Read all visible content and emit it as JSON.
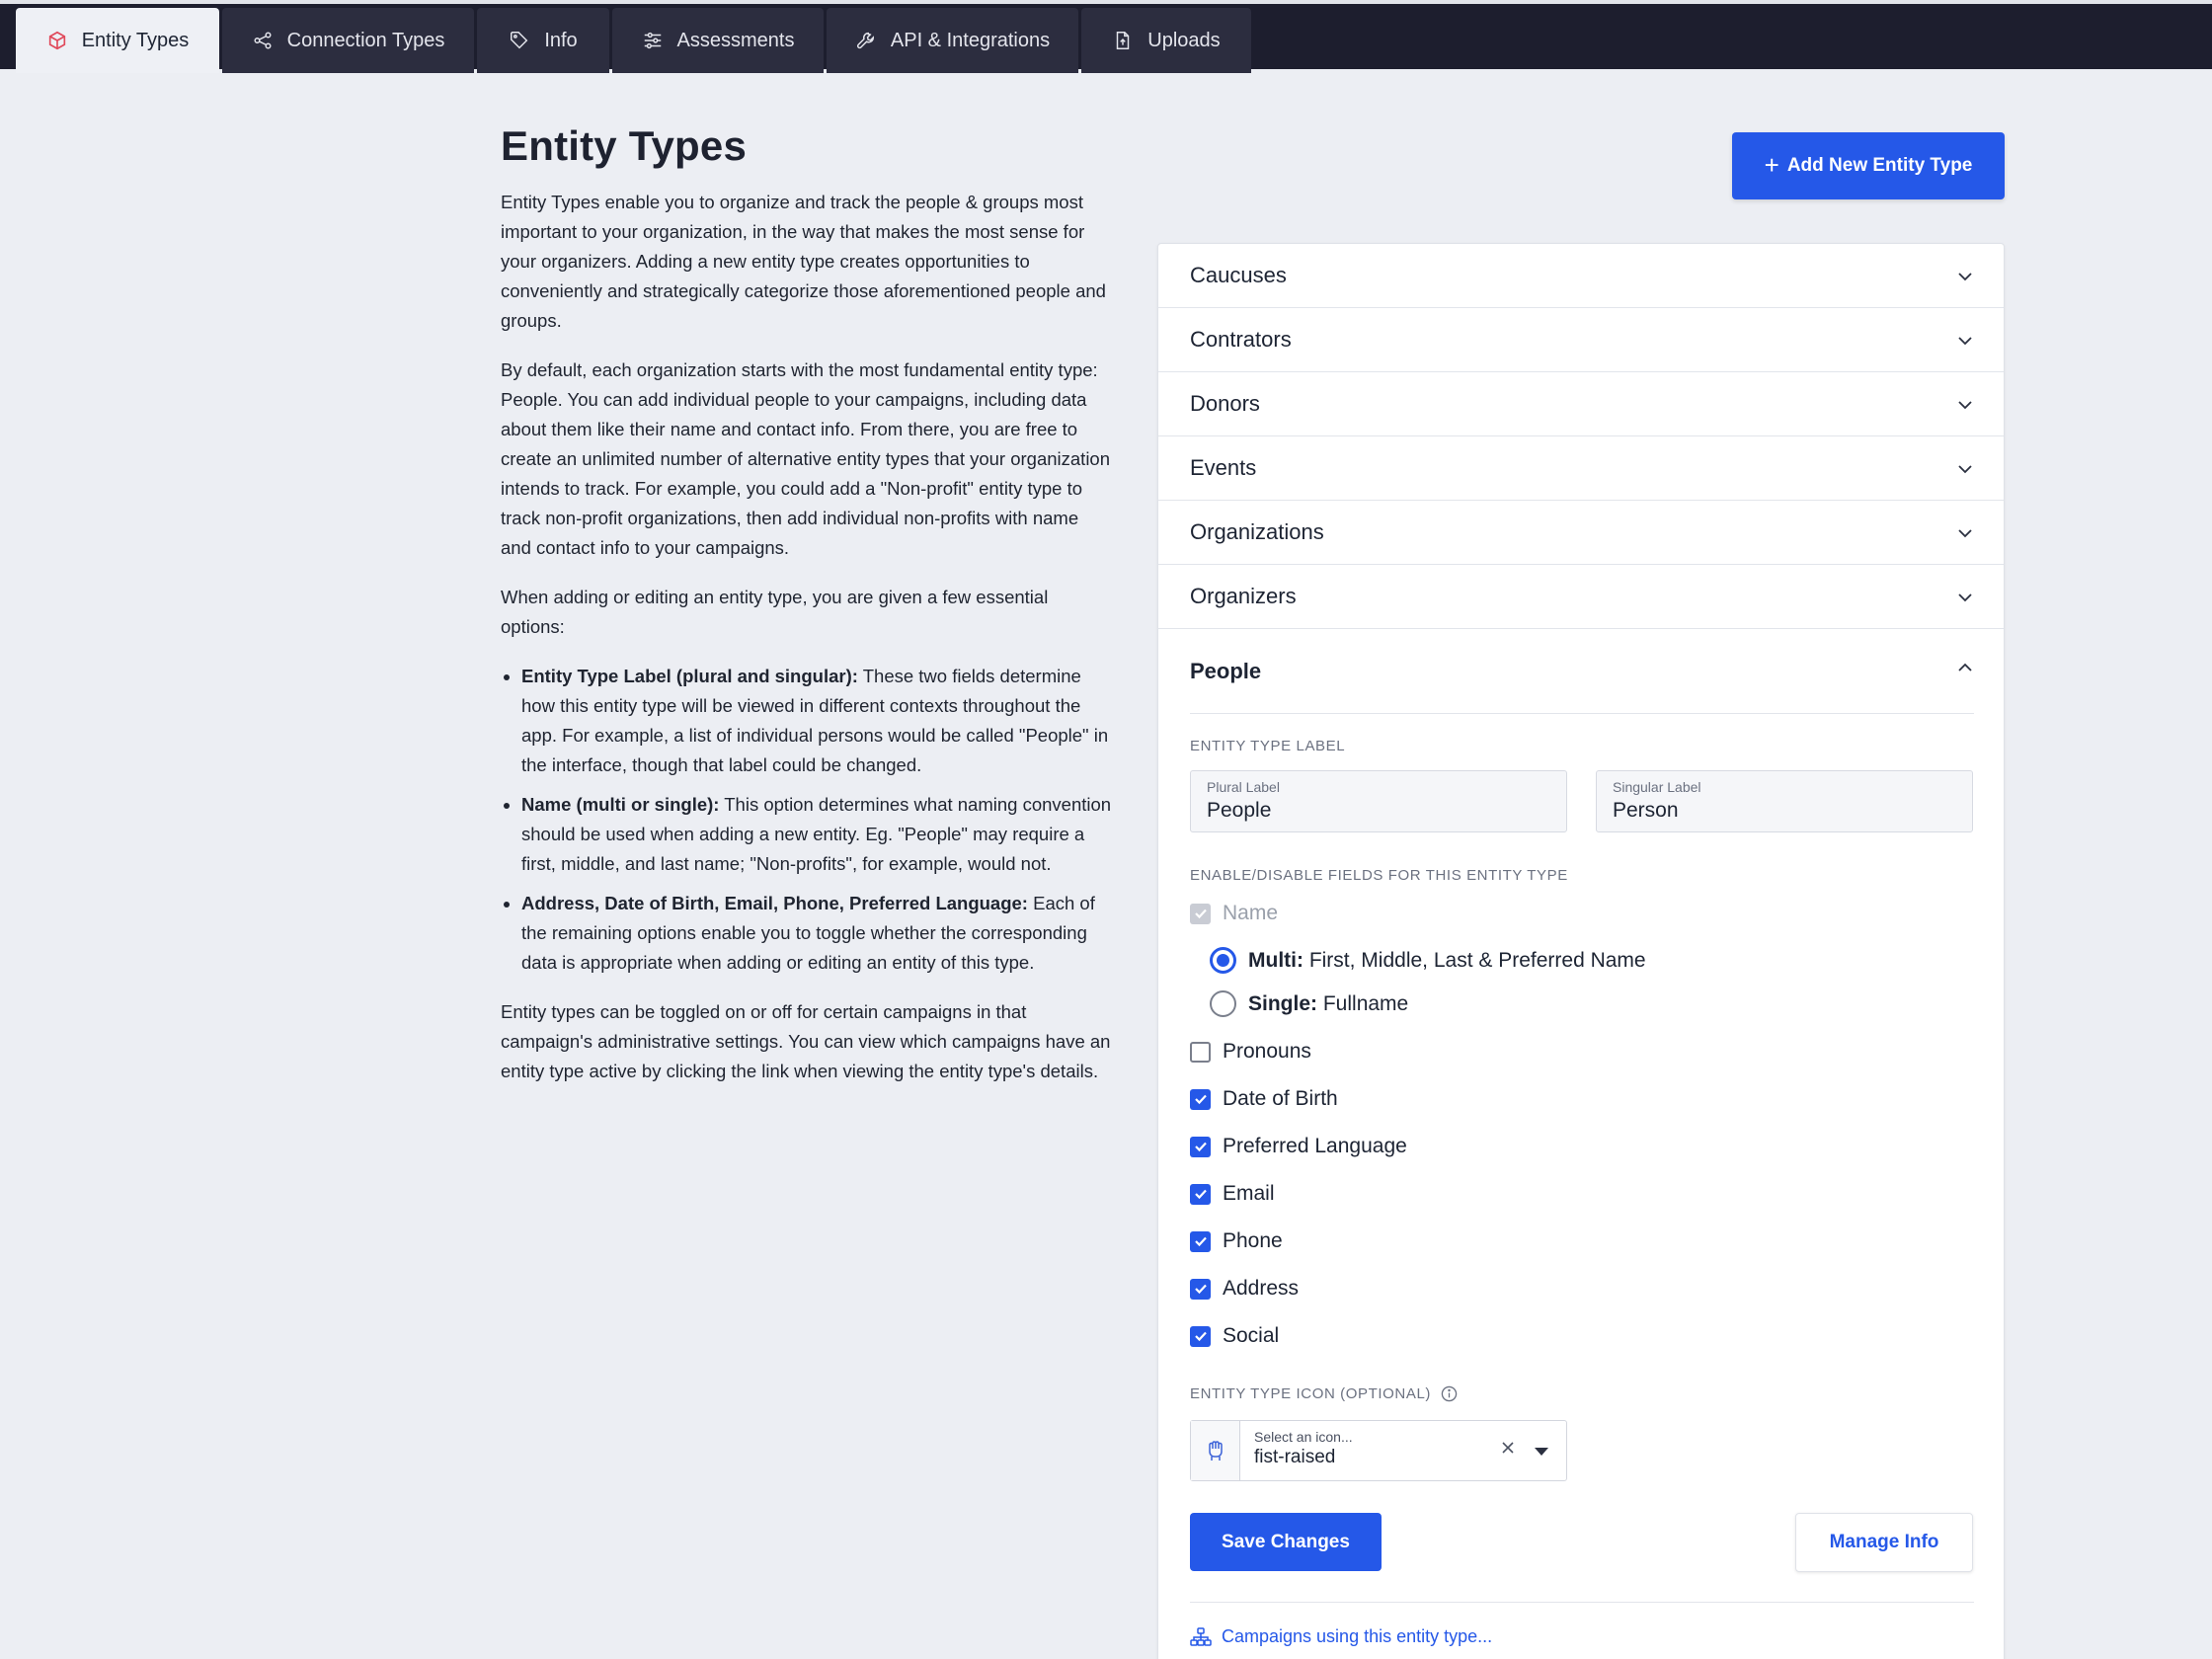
{
  "tabs": [
    {
      "label": "Entity Types",
      "icon": "cube-icon",
      "active": true
    },
    {
      "label": "Connection Types",
      "icon": "share-nodes-icon"
    },
    {
      "label": "Info",
      "icon": "tag-icon"
    },
    {
      "label": "Assessments",
      "icon": "sliders-icon"
    },
    {
      "label": "API & Integrations",
      "icon": "wrench-icon"
    },
    {
      "label": "Uploads",
      "icon": "file-upload-icon"
    }
  ],
  "page": {
    "title": "Entity Types",
    "intro_1": "Entity Types enable you to organize and track the people & groups most important to your organization, in the way that makes the most sense for your organizers. Adding a new entity type creates opportunities to conveniently and strategically categorize those aforementioned people and groups.",
    "intro_2": "By default, each organization starts with the most fundamental entity type: People. You can add individual people to your campaigns, including data about them like their name and contact info. From there, you are free to create an unlimited number of alternative entity types that your organization intends to track. For example, you could add a \"Non-profit\" entity type to track non-profit organizations, then add individual non-profits with name and contact info to your campaigns.",
    "intro_3": "When adding or editing an entity type, you are given a few essential options:",
    "bullets": [
      {
        "term": "Entity Type Label (plural and singular):",
        "text": " These two fields determine how this entity type will be viewed in different contexts throughout the app. For example, a list of individual persons would be called \"People\" in the interface, though that label could be changed."
      },
      {
        "term": "Name (multi or single):",
        "text": " This option determines what naming convention should be used when adding a new entity. Eg. \"People\" may require a first, middle, and last name; \"Non-profits\", for example, would not."
      },
      {
        "term": "Address, Date of Birth, Email, Phone, Preferred Language:",
        "text": " Each of the remaining options enable you to toggle whether the corresponding data is appropriate when adding or editing an entity of this type."
      }
    ],
    "outro": "Entity types can be toggled on or off for certain campaigns in that campaign's administrative settings. You can view which campaigns have an entity type active by clicking the link when viewing the entity type's details."
  },
  "add_button": {
    "label": "Add New Entity Type",
    "plus": "+"
  },
  "entity_types": [
    "Caucuses",
    "Contrators",
    "Donors",
    "Events",
    "Organizations",
    "Organizers"
  ],
  "open_entity": {
    "name": "People",
    "label_section": "ENTITY TYPE LABEL",
    "plural": {
      "label": "Plural Label",
      "value": "People"
    },
    "singular": {
      "label": "Singular Label",
      "value": "Person"
    },
    "fields_section": "ENABLE/DISABLE FIELDS FOR THIS ENTITY TYPE",
    "name_field": "Name",
    "name_options": [
      {
        "bold": "Multi:",
        "text": " First, Middle, Last & Preferred Name",
        "selected": true
      },
      {
        "bold": "Single:",
        "text": " Fullname",
        "selected": false
      }
    ],
    "fields": [
      {
        "label": "Pronouns",
        "checked": false
      },
      {
        "label": "Date of Birth",
        "checked": true
      },
      {
        "label": "Preferred Language",
        "checked": true
      },
      {
        "label": "Email",
        "checked": true
      },
      {
        "label": "Phone",
        "checked": true
      },
      {
        "label": "Address",
        "checked": true
      },
      {
        "label": "Social",
        "checked": true
      }
    ],
    "icon_section": "ENTITY TYPE ICON (OPTIONAL)",
    "icon_select": {
      "placeholder": "Select an icon...",
      "value": "fist-raised",
      "icon": "fist-raised-icon"
    },
    "save_label": "Save Changes",
    "manage_label": "Manage Info",
    "campaigns_link": "Campaigns using this entity type..."
  },
  "colors": {
    "accent": "#2558e8",
    "topbar": "#1d1e2e",
    "background": "#eceef3"
  }
}
